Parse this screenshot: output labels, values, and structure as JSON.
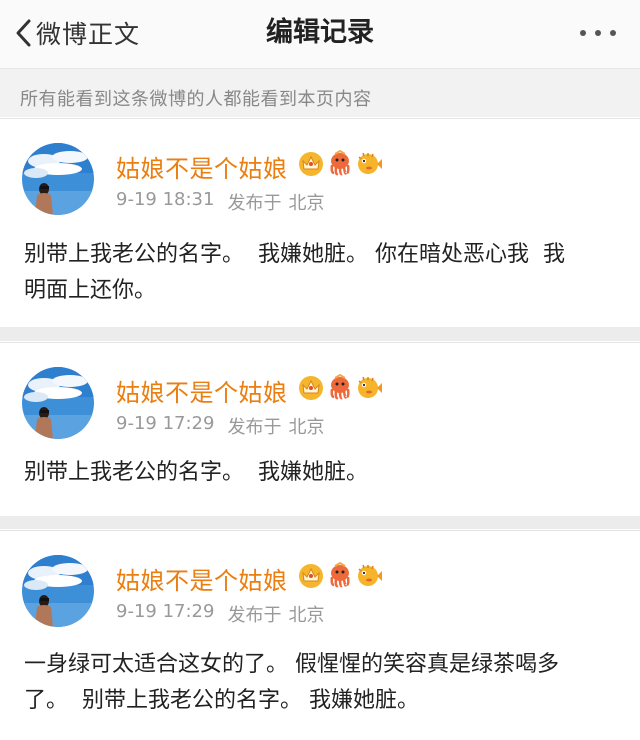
{
  "header": {
    "back_label": "微博正文",
    "title": "编辑记录",
    "more_icon": "more-dots-icon"
  },
  "notice": {
    "text": "所有能看到这条微博的人都能看到本页内容"
  },
  "colors": {
    "username": "#eb7e10",
    "meta": "#999999",
    "background": "#ececec"
  },
  "records": [
    {
      "username": "姑娘不是个姑娘",
      "time": "9-19 18:31",
      "location_prefix": "发布于",
      "location": "北京",
      "content": "别带上我老公的名字。  我嫌她脏。 你在暗处恶心我  我\n明面上还你。",
      "badges": [
        "crown-badge-icon",
        "octopus-badge-icon",
        "pufferfish-badge-icon"
      ]
    },
    {
      "username": "姑娘不是个姑娘",
      "time": "9-19 17:29",
      "location_prefix": "发布于",
      "location": "北京",
      "content": "别带上我老公的名字。  我嫌她脏。",
      "badges": [
        "crown-badge-icon",
        "octopus-badge-icon",
        "pufferfish-badge-icon"
      ]
    },
    {
      "username": "姑娘不是个姑娘",
      "time": "9-19 17:29",
      "location_prefix": "发布于",
      "location": "北京",
      "content": "一身绿可太适合这女的了。 假惺惺的笑容真是绿茶喝多\n了。  别带上我老公的名字。 我嫌她脏。",
      "badges": [
        "crown-badge-icon",
        "octopus-badge-icon",
        "pufferfish-badge-icon"
      ]
    }
  ]
}
